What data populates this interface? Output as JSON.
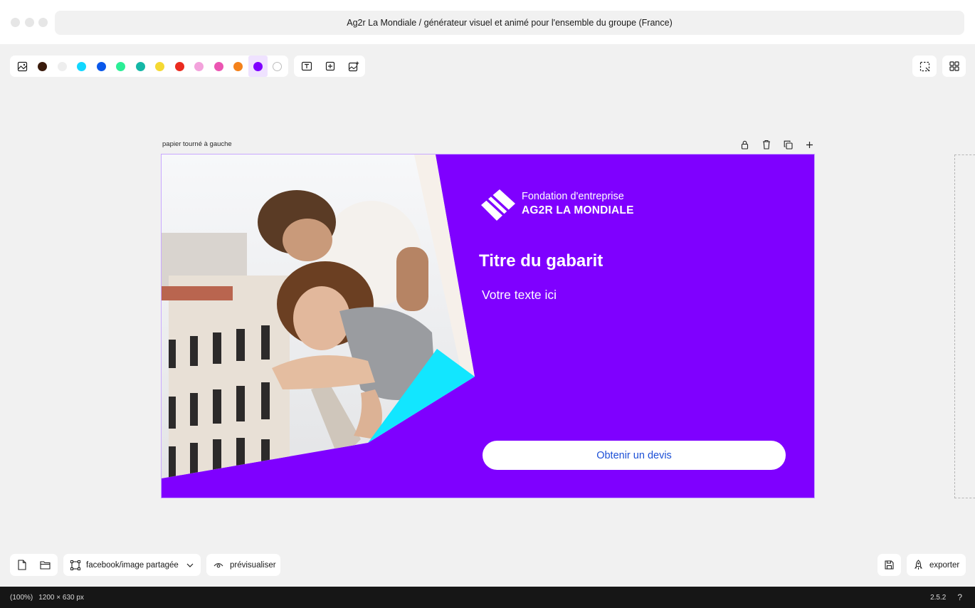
{
  "window": {
    "title": "Ag2r La Mondiale / générateur visuel et animé pour l'ensemble du groupe (France)"
  },
  "palette": {
    "colors": [
      "#3a1b0c",
      "#eeeeee",
      "#12d7ff",
      "#0a58ea",
      "#2bee96",
      "#14b7a6",
      "#f5d932",
      "#ea2b1f",
      "#f3a3dc",
      "#eb55b2",
      "#f4821b",
      "#7f00ff",
      "#ffffff"
    ],
    "selected_color": "#7f00ff"
  },
  "icons": {
    "image": "image-icon",
    "text_frame": "text-frame-icon",
    "add_box": "add-box-icon",
    "add_image": "add-image-icon",
    "selection": "selection-icon",
    "grid": "grid-icon",
    "lock": "lock-icon",
    "trash": "trash-icon",
    "duplicate": "duplicate-icon",
    "plus": "plus-icon"
  },
  "canvas": {
    "layout_name": "papier tourné à gauche",
    "artboard": {
      "background": "#7f00ff",
      "logo_line1": "Fondation d'entreprise",
      "logo_line2": "AG2R LA MONDIALE",
      "title": "Titre du gabarit",
      "body": "Votre texte ici",
      "cta": "Obtenir un devis",
      "accent": "#12e6ff"
    }
  },
  "bottom": {
    "format_label": "facebook/image partagée",
    "preview_label": "prévisualiser",
    "export_label": "exporter"
  },
  "status": {
    "zoom": "(100%)",
    "dimensions": "1200 × 630 px",
    "version": "2.5.2",
    "help": "?"
  }
}
